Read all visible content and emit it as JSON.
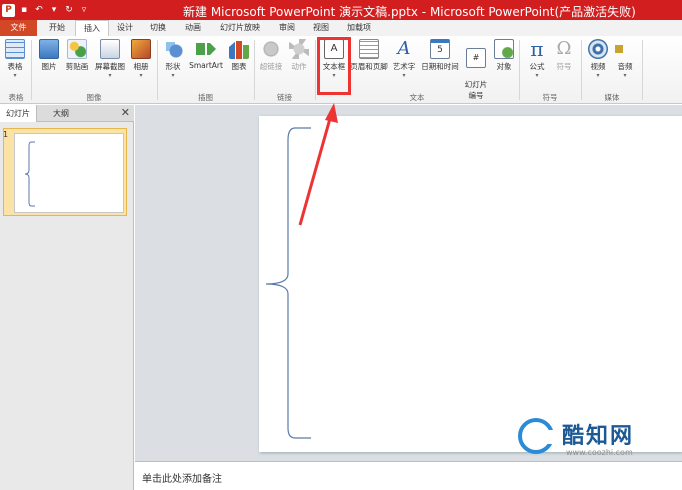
{
  "window": {
    "title": "新建 Microsoft PowerPoint 演示文稿.pptx - Microsoft PowerPoint(产品激活失败)"
  },
  "qat": {
    "logo": "P"
  },
  "tabs": [
    {
      "label": "文件"
    },
    {
      "label": "开始"
    },
    {
      "label": "插入"
    },
    {
      "label": "设计"
    },
    {
      "label": "切换"
    },
    {
      "label": "动画"
    },
    {
      "label": "幻灯片放映"
    },
    {
      "label": "审阅"
    },
    {
      "label": "视图"
    },
    {
      "label": "加载项"
    }
  ],
  "ribbon": {
    "buttons": [
      {
        "label": "表格",
        "icon": "table-icon"
      },
      {
        "label": "图片",
        "icon": "picture-icon"
      },
      {
        "label": "剪贴画",
        "icon": "clipart-icon"
      },
      {
        "label": "屏幕截图",
        "icon": "screenshot-icon"
      },
      {
        "label": "相册",
        "icon": "album-icon"
      },
      {
        "label": "形状",
        "icon": "shapes-icon"
      },
      {
        "label": "SmartArt",
        "icon": "smartart-icon"
      },
      {
        "label": "图表",
        "icon": "chart-icon"
      },
      {
        "label": "超链接",
        "icon": "hyperlink-icon"
      },
      {
        "label": "动作",
        "icon": "action-icon"
      },
      {
        "label": "文本框",
        "icon": "textbox-icon"
      },
      {
        "label": "页眉和页脚",
        "icon": "header-footer-icon"
      },
      {
        "label": "艺术字",
        "icon": "wordart-icon"
      },
      {
        "label": "日期和时间",
        "icon": "datetime-icon"
      },
      {
        "label": "幻灯片\n编号",
        "icon": "slide-number-icon"
      },
      {
        "label": "对象",
        "icon": "object-icon"
      },
      {
        "label": "公式",
        "icon": "equation-icon"
      },
      {
        "label": "符号",
        "icon": "symbol-icon"
      },
      {
        "label": "视频",
        "icon": "video-icon"
      },
      {
        "label": "音频",
        "icon": "audio-icon"
      }
    ],
    "groups": [
      {
        "label": "表格"
      },
      {
        "label": "图像"
      },
      {
        "label": "插图"
      },
      {
        "label": "链接"
      },
      {
        "label": "文本"
      },
      {
        "label": "符号"
      },
      {
        "label": "媒体"
      }
    ]
  },
  "left_panel": {
    "tabs": [
      {
        "label": "幻灯片"
      },
      {
        "label": "大纲"
      }
    ],
    "close": "✕",
    "slide_number": "1"
  },
  "notes": {
    "placeholder": "单击此处添加备注"
  },
  "watermark": {
    "title": "酷知网",
    "url": "www.coozhi.com"
  },
  "colors": {
    "accent": "#d21e1e",
    "file_tab": "#d24726",
    "highlight": "#ee3333"
  }
}
